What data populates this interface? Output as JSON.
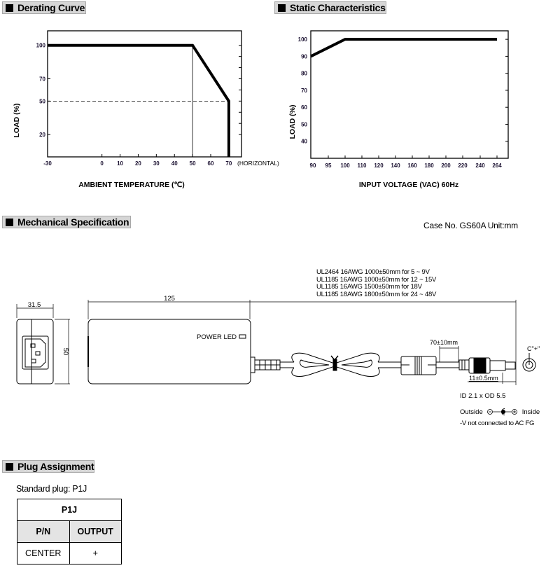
{
  "sections": {
    "derating": "Derating Curve",
    "static": "Static Characteristics",
    "mechanical": "Mechanical Specification",
    "plug": "Plug Assignment"
  },
  "chart_data": [
    {
      "type": "line",
      "title": "Derating Curve",
      "xlabel": "AMBIENT TEMPERATURE (℃)",
      "ylabel": "LOAD (%)",
      "x_ticks": [
        "-30",
        "0",
        "10",
        "20",
        "30",
        "40",
        "50",
        "60",
        "70"
      ],
      "x_tick_values": [
        -30,
        0,
        10,
        20,
        30,
        40,
        50,
        60,
        70
      ],
      "x_annotation": "(HORIZONTAL)",
      "y_ticks": [
        "100",
        "70",
        "50",
        "20"
      ],
      "y_tick_values": [
        100,
        70,
        50,
        20
      ],
      "y_minor_ticks": [
        90,
        80,
        60,
        40,
        30
      ],
      "xlim": [
        -30,
        77
      ],
      "ylim": [
        0,
        113
      ],
      "series": [
        {
          "name": "load",
          "x": [
            -30,
            50,
            70,
            70
          ],
          "y": [
            100,
            100,
            50,
            0
          ]
        }
      ],
      "reference_lines": [
        {
          "orientation": "vertical",
          "value": 50,
          "style": "solid-thin",
          "from": 0,
          "to": 100
        },
        {
          "orientation": "horizontal",
          "value": 50,
          "style": "dashed",
          "from": -30,
          "to": 70
        }
      ],
      "grid": false
    },
    {
      "type": "line",
      "title": "Static Characteristics",
      "xlabel": "INPUT VOLTAGE (VAC) 60Hz",
      "ylabel": "LOAD (%)",
      "x_ticks": [
        "90",
        "95",
        "100",
        "110",
        "120",
        "140",
        "160",
        "180",
        "200",
        "220",
        "240",
        "264"
      ],
      "y_ticks": [
        "100",
        "90",
        "80",
        "70",
        "60",
        "50",
        "40"
      ],
      "y_tick_values": [
        100,
        90,
        80,
        70,
        60,
        50,
        40
      ],
      "ylim": [
        30,
        105
      ],
      "series": [
        {
          "name": "load",
          "x": [
            "90",
            "100",
            "264"
          ],
          "y": [
            90,
            100,
            100
          ]
        }
      ],
      "grid": false
    }
  ],
  "mechanical": {
    "case_info": "Case No. GS60A    Unit:mm",
    "dim_width": "31.5",
    "dim_height": "50",
    "dim_length": "125",
    "power_led_label": "POWER LED",
    "cable_specs": [
      "UL2464 16AWG 1000±50mm for 5 ~ 9V",
      "UL1185 16AWG 1000±50mm for 12 ~ 15V",
      "UL1185 16AWG 1500±50mm for 18V",
      "UL1185 18AWG 1800±50mm for 24 ~ 48V"
    ],
    "dim_ferrite": "70±10mm",
    "dim_plug": "11±0.5mm",
    "plug_center_label": "C\"+\"",
    "plug_size": "ID 2.1 x OD 5.5",
    "outside_label": "Outside",
    "inside_label": "Inside",
    "note": "-V not connected to AC FG"
  },
  "plug_assignment": {
    "standard_plug": "Standard plug: P1J",
    "table_title": "P1J",
    "headers": [
      "P/N",
      "OUTPUT"
    ],
    "rows": [
      [
        "CENTER",
        "+"
      ]
    ]
  }
}
